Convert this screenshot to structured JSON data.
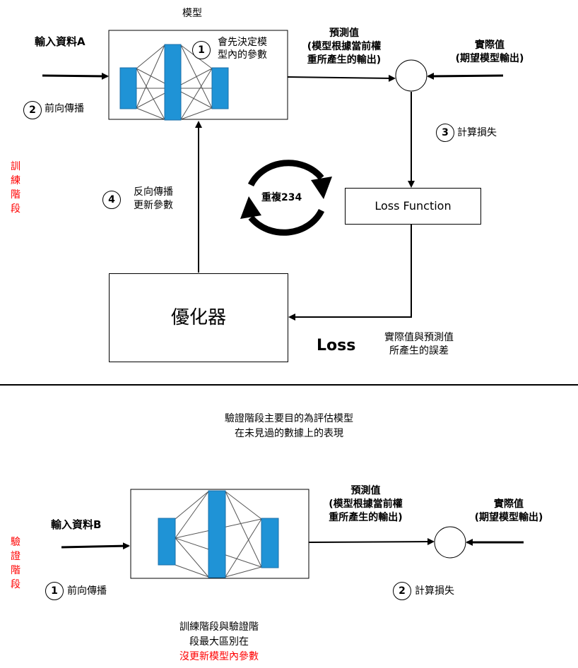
{
  "train": {
    "model_title": "模型",
    "input_label": "輸入資料A",
    "step1_num": "1",
    "step1_text_line1": "會先決定模",
    "step1_text_line2": "型內的參數",
    "step2_num": "2",
    "step2_text": "前向傳播",
    "prediction_line1": "預測值",
    "prediction_line2": "(模型根據當前權",
    "prediction_line3": "重所產生的輸出)",
    "actual_line1": "實際值",
    "actual_line2": "(期望模型輸出)",
    "step3_num": "3",
    "step3_text": "計算損失",
    "loss_function": "Loss Function",
    "repeat_text": "重複234",
    "step4_num": "4",
    "step4_line1": "反向傳播",
    "step4_line2": "更新參數",
    "optimizer": "優化器",
    "loss_label": "Loss",
    "loss_desc_line1": "實際值與預測值",
    "loss_desc_line2": "所產生的誤差",
    "phase_label": "訓練階段"
  },
  "validation": {
    "intro_line1": "驗證階段主要目的為評估模型",
    "intro_line2": "在未見過的數據上的表現",
    "input_label": "輸入資料B",
    "prediction_line1": "預測值",
    "prediction_line2": "(模型根據當前權",
    "prediction_line3": "重所產生的輸出)",
    "actual_line1": "實際值",
    "actual_line2": "(期望模型輸出)",
    "step1_num": "1",
    "step1_text": "前向傳播",
    "step2_num": "2",
    "step2_text": "計算損失",
    "diff_line1": "訓練階段與驗證階",
    "diff_line2": "段最大區別在",
    "diff_line3": "沒更新模型內參數",
    "phase_label": "驗證階段"
  },
  "colors": {
    "layer_blue": "#1f93d6",
    "accent_red": "#ff0000",
    "line_black": "#000000"
  }
}
